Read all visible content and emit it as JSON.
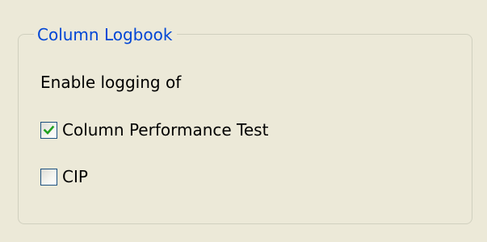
{
  "groupbox": {
    "title": "Column Logbook",
    "intro_text": "Enable logging of"
  },
  "options": [
    {
      "label": "Column Performance Test",
      "checked": true
    },
    {
      "label": "CIP",
      "checked": false
    }
  ],
  "colors": {
    "background": "#ece9d8",
    "title": "#0046d5",
    "check_mark": "#21a121",
    "checkbox_border": "#1c5180",
    "group_border": "#d0d0bf"
  },
  "icons": {
    "checked": "check-mark-icon"
  }
}
